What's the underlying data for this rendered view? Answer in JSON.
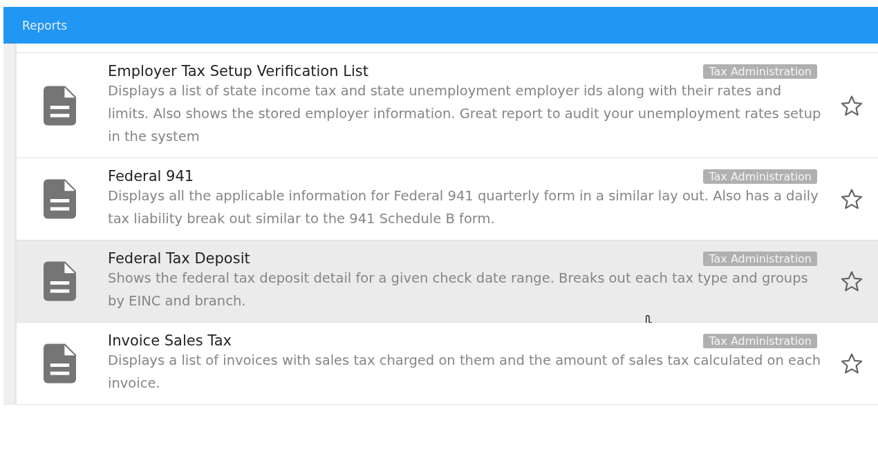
{
  "header": {
    "title": "Reports"
  },
  "reports": [
    {
      "title": "Employer Tax Setup Verification List",
      "category": "Tax Administration",
      "description": "Displays a list of state income tax and state unemployment employer ids along with their rates and limits. Also shows the stored employer information. Great report to audit your unemployment rates setup in the system",
      "favorite": false,
      "highlighted": false
    },
    {
      "title": "Federal 941",
      "category": "Tax Administration",
      "description": "Displays all the applicable information for Federal 941 quarterly form in a similar lay out. Also has a daily tax liability break out similar to the 941 Schedule B form.",
      "favorite": false,
      "highlighted": false
    },
    {
      "title": "Federal Tax Deposit",
      "category": "Tax Administration",
      "description": "Shows the federal tax deposit detail for a given check date range. Breaks out each tax type and groups by EINC and branch.",
      "favorite": false,
      "highlighted": true
    },
    {
      "title": "Invoice Sales Tax",
      "category": "Tax Administration",
      "description": "Displays a list of invoices with sales tax charged on them and the amount of sales tax calculated on each invoice.",
      "favorite": false,
      "highlighted": false
    }
  ]
}
